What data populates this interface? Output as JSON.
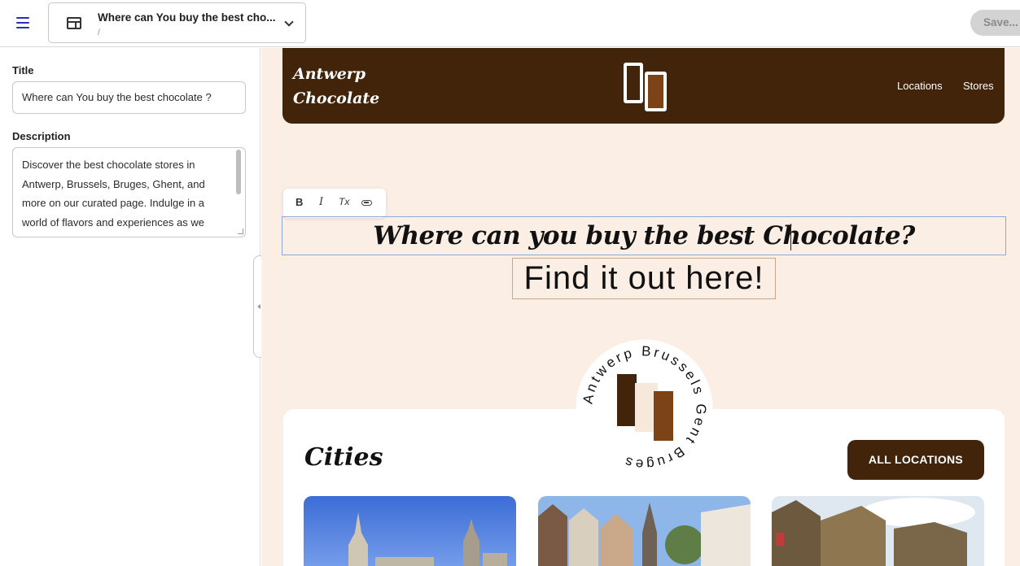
{
  "topbar": {
    "page_title": "Where can You buy the best cho...",
    "page_path": "/",
    "save_label": "Save..."
  },
  "sidebar": {
    "title_label": "Title",
    "title_value": "Where can You buy the best chocolate ?",
    "description_label": "Description",
    "description_lines": [
      "Discover the best chocolate stores in",
      "Antwerp, Brussels, Bruges, Ghent, and",
      "more on our curated page. Indulge in a",
      "world of flavors and experiences as we"
    ]
  },
  "site": {
    "brand_line1": "Antwerp",
    "brand_line2": "Chocolate",
    "nav": [
      "Locations",
      "Stores"
    ],
    "toolbar": {
      "bold": "B",
      "italic": "I",
      "clear": "Tx"
    },
    "headline": "Where can you buy the best Chocolate?",
    "subheadline": "Find it out here!",
    "badge_text": "Antwerp Brussels Gent Bruges",
    "cities_title": "Cities",
    "all_locations_label": "ALL LOCATIONS"
  },
  "colors": {
    "brand_brown": "#42240b",
    "canvas_bg": "#fbeee5",
    "accent_blue": "#2a2fb3",
    "chocolate_light": "#7b4316"
  }
}
